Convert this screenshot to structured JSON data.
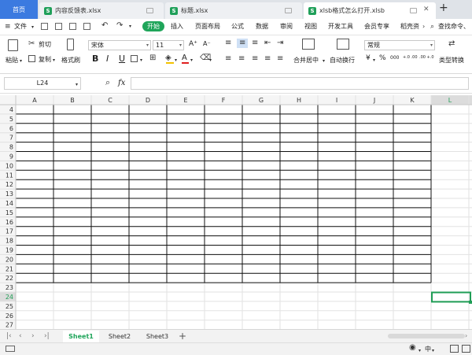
{
  "tabs": {
    "home": "首页",
    "items": [
      {
        "label": "内容反馈表.xlsx",
        "active": false
      },
      {
        "label": "标题.xlsx",
        "active": false
      },
      {
        "label": "xlsb格式怎么打开.xlsb",
        "active": true
      }
    ],
    "new_tab": "+"
  },
  "menubar": {
    "file": "文件",
    "items": [
      "开始",
      "插入",
      "页面布局",
      "公式",
      "数据",
      "审阅",
      "视图",
      "开发工具",
      "会员专享",
      "稻壳资"
    ],
    "search": "查找命令、"
  },
  "ribbon": {
    "paste": "粘贴",
    "cut": "剪切",
    "copy": "复制",
    "format_painter": "格式刷",
    "font_name": "宋体",
    "font_size": "11",
    "bold": "B",
    "italic": "I",
    "underline": "U",
    "grow_font": "A⁺",
    "shrink_font": "A⁻",
    "merge_center": "合并居中",
    "wrap_text": "自动换行",
    "number_format": "常规",
    "currency": "¥",
    "percent": "%",
    "thousands": "000",
    "inc_decimal": "+.0 .00",
    "dec_decimal": ".00 +.0",
    "type_convert": "类型转换"
  },
  "formula_bar": {
    "name_box": "L24",
    "fx": "fx",
    "formula": ""
  },
  "grid": {
    "columns": [
      "A",
      "B",
      "C",
      "D",
      "E",
      "F",
      "G",
      "H",
      "I",
      "J",
      "K",
      "L"
    ],
    "rows": [
      "4",
      "5",
      "6",
      "7",
      "8",
      "9",
      "10",
      "11",
      "12",
      "13",
      "14",
      "15",
      "16",
      "17",
      "18",
      "19",
      "20",
      "21",
      "22",
      "23",
      "24",
      "25",
      "26",
      "27"
    ],
    "selected_column": "L",
    "selected_row": "24",
    "bordered_rows_last": "22",
    "bordered_columns_last": "K"
  },
  "sheets": {
    "items": [
      "Sheet1",
      "Sheet2",
      "Sheet3"
    ],
    "active": "Sheet1",
    "add": "+"
  },
  "status": {
    "input_mode": "中"
  },
  "colors": {
    "accent_green": "#1fa55a",
    "home_blue": "#3b7ae0",
    "selection_green": "#1f9d55"
  }
}
